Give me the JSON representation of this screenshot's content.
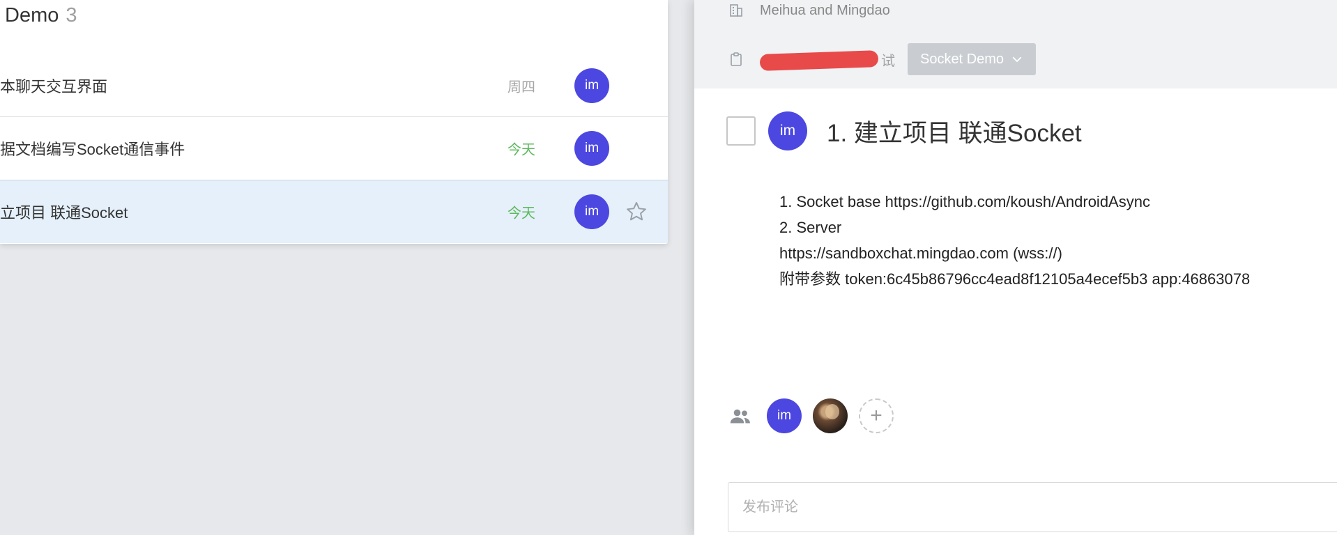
{
  "left": {
    "header": {
      "title": "Demo",
      "count": "3"
    },
    "tasks": [
      {
        "title": "本聊天交互界面",
        "date": "周四",
        "date_color": "#a5a5a5",
        "avatar": "im",
        "selected": false
      },
      {
        "title": "据文档编写Socket通信事件",
        "date": "今天",
        "date_color": "#5cb85c",
        "avatar": "im",
        "selected": false
      },
      {
        "title": "立项目 联通Socket",
        "date": "今天",
        "date_color": "#5cb85c",
        "avatar": "im",
        "selected": true
      }
    ]
  },
  "right": {
    "project_name": "Meihua and Mingdao",
    "folder_suffix": "试",
    "stage_button": "Socket Demo",
    "task": {
      "title": "1. 建立项目 联通Socket",
      "avatar": "im",
      "description": [
        "1. Socket base https://github.com/koush/AndroidAsync",
        "2. Server",
        "https://sandboxchat.mingdao.com (wss://)",
        "附带参数 token:6c45b86796cc4ead8f12105a4ecef5b3 app:46863078"
      ]
    },
    "members": {
      "avatar_1": "im",
      "add_symbol": "+"
    },
    "comment": {
      "placeholder": "发布评论"
    }
  },
  "colors": {
    "accent_avatar": "#4b47e0",
    "today_green": "#5cb85c",
    "selected_row": "#e5f0fa",
    "redaction": "#e84a4a"
  },
  "icons": [
    "building-icon",
    "clipboard-icon",
    "chevron-down-icon",
    "star-icon",
    "people-icon",
    "plus-icon"
  ]
}
